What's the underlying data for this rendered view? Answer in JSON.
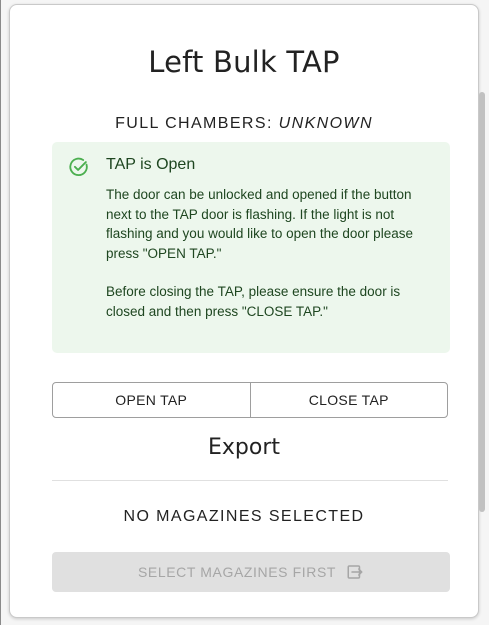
{
  "card": {
    "title": "Left Bulk TAP",
    "full_chambers_label": "FULL CHAMBERS:",
    "full_chambers_value": "UNKNOWN"
  },
  "alert": {
    "icon": "check-circle-icon",
    "title": "TAP is Open",
    "paragraph1": "The door can be unlocked and opened if the button next to the TAP door is flashing. If the light is not flashing and you would like to open the door please press \"OPEN TAP.\"",
    "paragraph2": "Before closing the TAP, please ensure the door is closed and then press \"CLOSE TAP.\"",
    "background": "#edf7ed",
    "text_color": "#1e4620",
    "icon_color": "#4caf50"
  },
  "buttons": {
    "open_label": "OPEN TAP",
    "close_label": "CLOSE TAP"
  },
  "export": {
    "title": "Export",
    "status": "NO MAGAZINES SELECTED",
    "select_button_label": "SELECT MAGAZINES FIRST",
    "select_button_icon": "export-icon"
  }
}
